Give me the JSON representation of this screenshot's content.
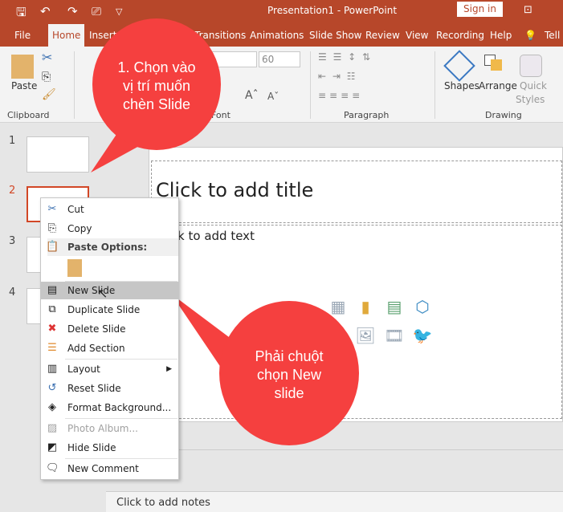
{
  "titlebar": {
    "title": "Presentation1  -  PowerPoint",
    "sign_in": "Sign in"
  },
  "tabs": [
    "File",
    "Home",
    "Insert",
    "Transitions",
    "Animations",
    "Slide Show",
    "Review",
    "View",
    "Recording",
    "Help",
    "Tell"
  ],
  "ribbon": {
    "clipboard": {
      "label": "Clipboard",
      "paste": "Paste"
    },
    "font": {
      "label": "Font",
      "size": "60"
    },
    "paragraph": {
      "label": "Paragraph"
    },
    "drawing": {
      "label": "Drawing",
      "shapes": "Shapes",
      "arrange": "Arrange",
      "quick": "Quick",
      "styles": "Styles"
    }
  },
  "thumbnails": {
    "numbers": [
      "1",
      "2",
      "3",
      "4"
    ],
    "selected": 2
  },
  "slide": {
    "title_placeholder": "Click to add title",
    "body_placeholder": "Click to add text"
  },
  "notes": {
    "placeholder": "Click to add notes"
  },
  "context_menu": {
    "cut": "Cut",
    "copy": "Copy",
    "paste_options": "Paste Options:",
    "new_slide": "New Slide",
    "duplicate": "Duplicate Slide",
    "delete": "Delete Slide",
    "add_section": "Add Section",
    "layout": "Layout",
    "reset": "Reset Slide",
    "format_bg": "Format Background...",
    "photo_album": "Photo Album...",
    "hide": "Hide Slide",
    "new_comment": "New Comment"
  },
  "callouts": {
    "first": [
      "1. Chọn vào",
      "vị trí muốn",
      "chèn Slide"
    ],
    "second": [
      "Phải chuột",
      "chọn New",
      "slide"
    ],
    "color": "#f5403f"
  },
  "colors": {
    "accent": "#b7472a",
    "selected_border": "#d24726"
  }
}
